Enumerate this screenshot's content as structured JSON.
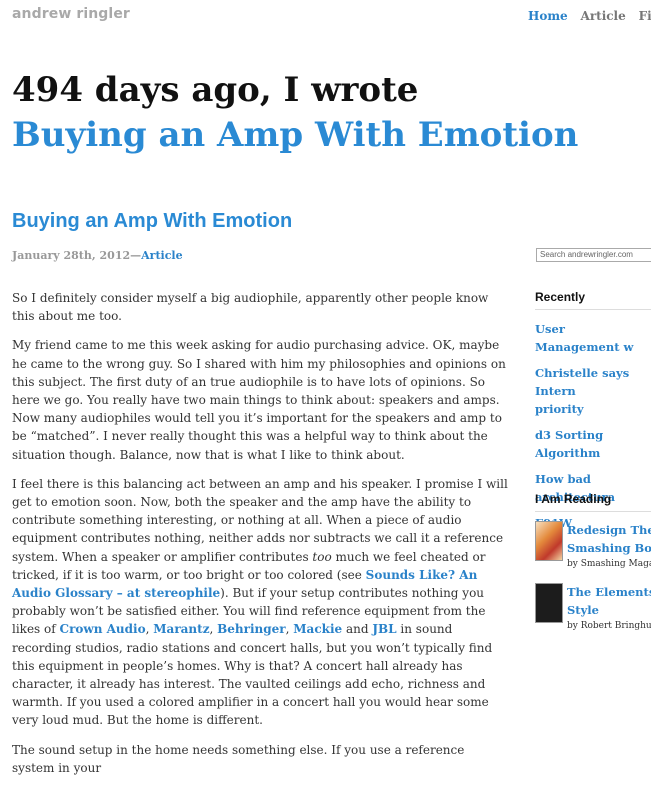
{
  "site": {
    "brand": "andrew ringler"
  },
  "nav": [
    {
      "label": "Home",
      "active": true
    },
    {
      "label": "Article",
      "active": false
    },
    {
      "label": "Film",
      "active": false
    }
  ],
  "hero": {
    "line1": "494 days ago, I wrote",
    "line2": "Buying an Amp With Emotion"
  },
  "post": {
    "title": "Buying an Amp With Emotion",
    "date": "January 28th, 2012",
    "sep": "—",
    "category": "Article",
    "p1": "So I definitely consider myself a big audiophile, apparently other people know this about me too.",
    "p2": "My friend came to me this week asking for audio purchasing advice. OK, maybe he came to the wrong guy. So I shared with him my philosophies and opinions on this subject. The first duty of an true audiophile is to have lots of opinions. So here we go. You really have two main things to think about: speakers and amps. Now many audiophiles would tell you it’s important for the speakers and amp to be “matched”. I never really thought this was a helpful way to think about the situation though. Balance, now that is what I like to think about.",
    "p3": {
      "a": "I feel there is this balancing act between an amp and his speaker. I promise I will get to emotion soon. Now, both the speaker and the amp have the ability to contribute something interesting, or nothing at all. When a piece of audio equipment contributes nothing, neither adds nor subtracts we call it a reference system. When a speaker or amplifier contributes ",
      "em": "too",
      "b": " much we feel cheated or tricked, if it is too warm, or too bright or too colored (see ",
      "link1": "Sounds Like? An Audio Glossary – at stereophile",
      "c": "). But if your setup contributes nothing you probably won’t be satisfied either. You will find reference equipment from the likes of ",
      "link2": "Crown Audio",
      "comma1": ", ",
      "link3": "Marantz",
      "comma2": ", ",
      "link4": "Behringer",
      "comma3": ", ",
      "link5": "Mackie",
      "and": " and ",
      "link6": "JBL",
      "d": " in sound recording studios, radio stations and concert halls, but you won’t typically find this equipment in people’s homes. Why is that? A concert hall already has character, it already has interest. The vaulted ceilings add echo, richness and warmth. If you used a colored amplifier in a concert hall you would hear some very loud mud. But the home is different."
    },
    "p4": "The sound setup in the home needs something else. If you use a reference system in your"
  },
  "sidebar": {
    "search_placeholder": "Search andrewringler.com",
    "recent_heading": "Recently",
    "recent": [
      "User Management w",
      "Christelle says Intern\npriority",
      "d3 Sorting Algorithm",
      "How bad architectura",
      "F91W"
    ],
    "reading_heading": "I Am Reading",
    "books": [
      {
        "title": "Redesign The W\nSmashing Book",
        "author": "by Smashing Magaz"
      },
      {
        "title": "The Elements o\nStyle",
        "author": "by Robert Bringhurs"
      }
    ]
  },
  "colors": {
    "accent": "#2a8ad4",
    "link": "#2a82c9",
    "muted": "#a9a9a9"
  }
}
